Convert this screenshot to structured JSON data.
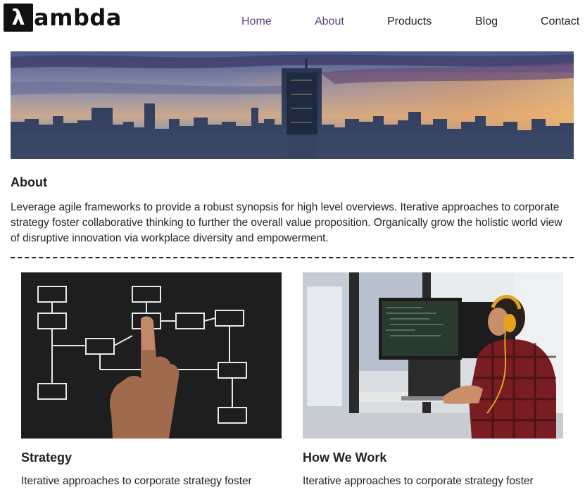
{
  "brand": {
    "logo_glyph": "λ",
    "logo_text": "ambda"
  },
  "nav": {
    "items": [
      {
        "label": "Home",
        "active": true
      },
      {
        "label": "About",
        "active": true
      },
      {
        "label": "Products",
        "active": false
      },
      {
        "label": "Blog",
        "active": false
      },
      {
        "label": "Contact",
        "active": false
      }
    ]
  },
  "colors": {
    "nav_active": "#5b3e86",
    "text": "#222222"
  },
  "about": {
    "title": "About",
    "body": "Leverage agile frameworks to provide a robust synopsis for high level overviews. Iterative approaches to corporate strategy foster collaborative thinking to further the overall value proposition. Organically grow the holistic world view of disruptive innovation via workplace diversity and empowerment."
  },
  "cards": [
    {
      "title": "Strategy",
      "text": "Iterative approaches to corporate strategy foster",
      "image": "flowchart-sketch-image"
    },
    {
      "title": "How We Work",
      "text": "Iterative approaches to corporate strategy foster",
      "image": "developer-workspace-image"
    }
  ]
}
